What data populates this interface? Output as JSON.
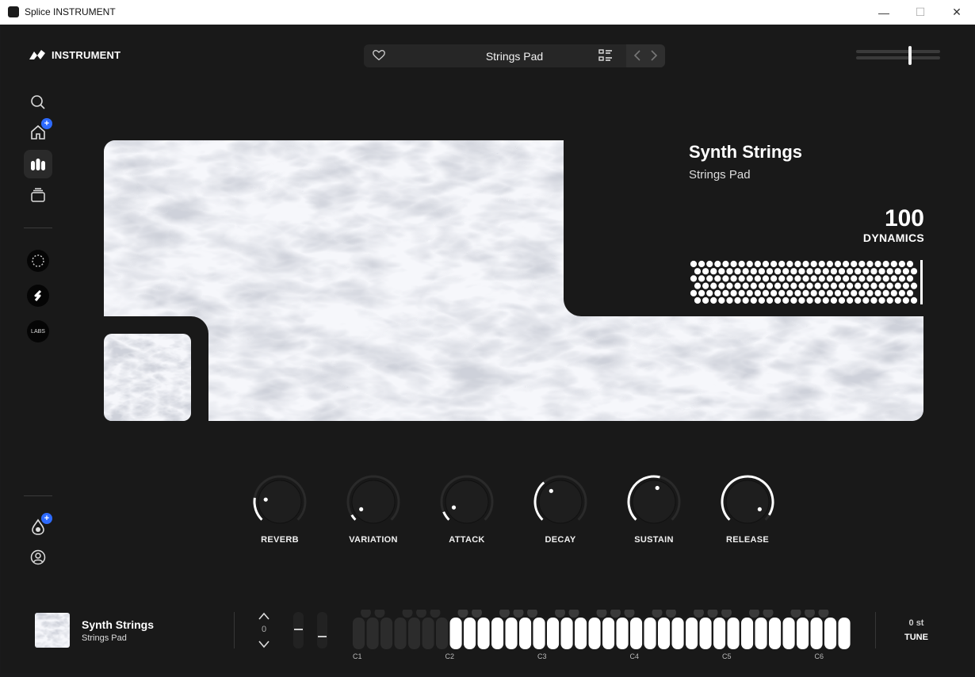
{
  "window": {
    "title": "Splice INSTRUMENT",
    "minimize": "—",
    "maximize": "☐",
    "close": "✕"
  },
  "brand": {
    "name": "INSTRUMENT"
  },
  "preset": {
    "name": "Strings Pad"
  },
  "sidebar": {
    "items": [
      {
        "name": "search-icon"
      },
      {
        "name": "home-icon",
        "badge": "+"
      },
      {
        "name": "instruments-icon"
      },
      {
        "name": "library-icon"
      }
    ],
    "labels_logo": {
      "text": "LABS"
    },
    "bottom_badge": "+"
  },
  "instrument": {
    "title": "Synth Strings",
    "preset": "Strings Pad"
  },
  "dynamics": {
    "value": "100",
    "label": "DYNAMICS"
  },
  "knobs": [
    {
      "label": "REVERB",
      "value": 0.2
    },
    {
      "label": "VARIATION",
      "value": 0.05
    },
    {
      "label": "ATTACK",
      "value": 0.08
    },
    {
      "label": "DECAY",
      "value": 0.35
    },
    {
      "label": "SUSTAIN",
      "value": 0.55
    },
    {
      "label": "RELEASE",
      "value": 0.95
    }
  ],
  "footer": {
    "title": "Synth Strings",
    "subtitle": "Strings Pad",
    "octave": "0",
    "octave_labels": [
      "C1",
      "C2",
      "C3",
      "C4",
      "C5",
      "C6"
    ],
    "tune_value": "0 st",
    "tune_label": "TUNE"
  },
  "colors": {
    "accent": "#2e6bff",
    "background": "#191919"
  }
}
